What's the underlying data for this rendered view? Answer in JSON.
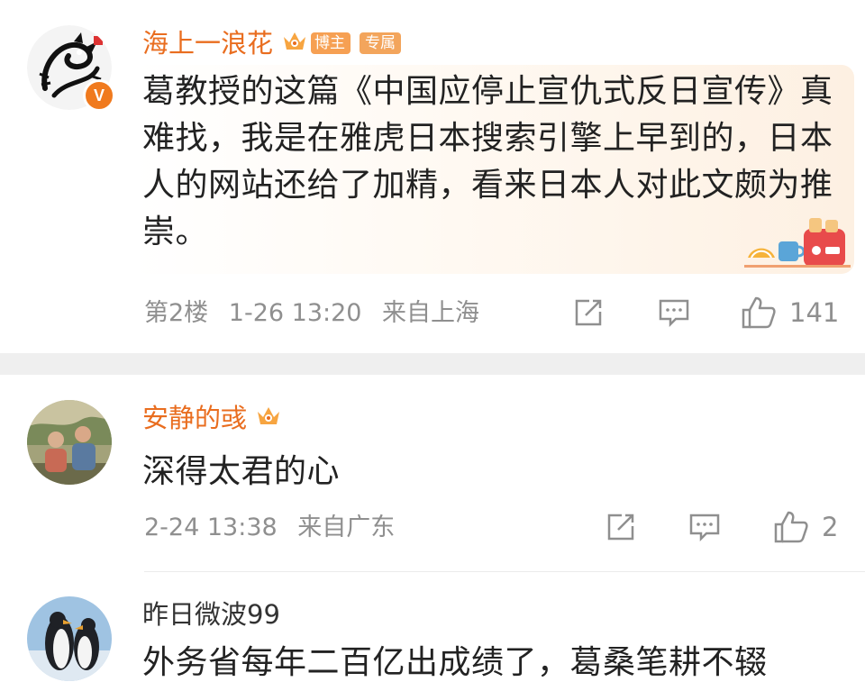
{
  "comments": [
    {
      "username": "海上一浪花",
      "badges": {
        "host": "博主",
        "exclusive": "专属"
      },
      "verified_mark": "V",
      "text": "葛教授的这篇《中国应停止宣仇式反日宣传》真难找，我是在雅虎日本搜索引擎上早到的，日本人的网站还给了加精，看来日本人对此文颇为推崇。",
      "floor": "第2楼",
      "time": "1-26 13:20",
      "location": "来自上海",
      "likes": "141"
    },
    {
      "username": "安静的彧",
      "text": "深得太君的心",
      "time": "2-24 13:38",
      "location": "来自广东",
      "likes": "2"
    },
    {
      "username": "昨日微波99",
      "text": "外务省每年二百亿出成绩了，葛桑笔耕不辍"
    }
  ],
  "colors": {
    "username_highlight": "#e96d1f",
    "badge_orange": "#f6a053",
    "meta_gray": "#8f8f8f",
    "text_dark": "#222222",
    "separator": "#efefef"
  },
  "icons": [
    "dragon-avatar",
    "verified-icon",
    "crown-icon",
    "share-icon",
    "comment-icon",
    "like-icon",
    "breakfast-decoration"
  ]
}
